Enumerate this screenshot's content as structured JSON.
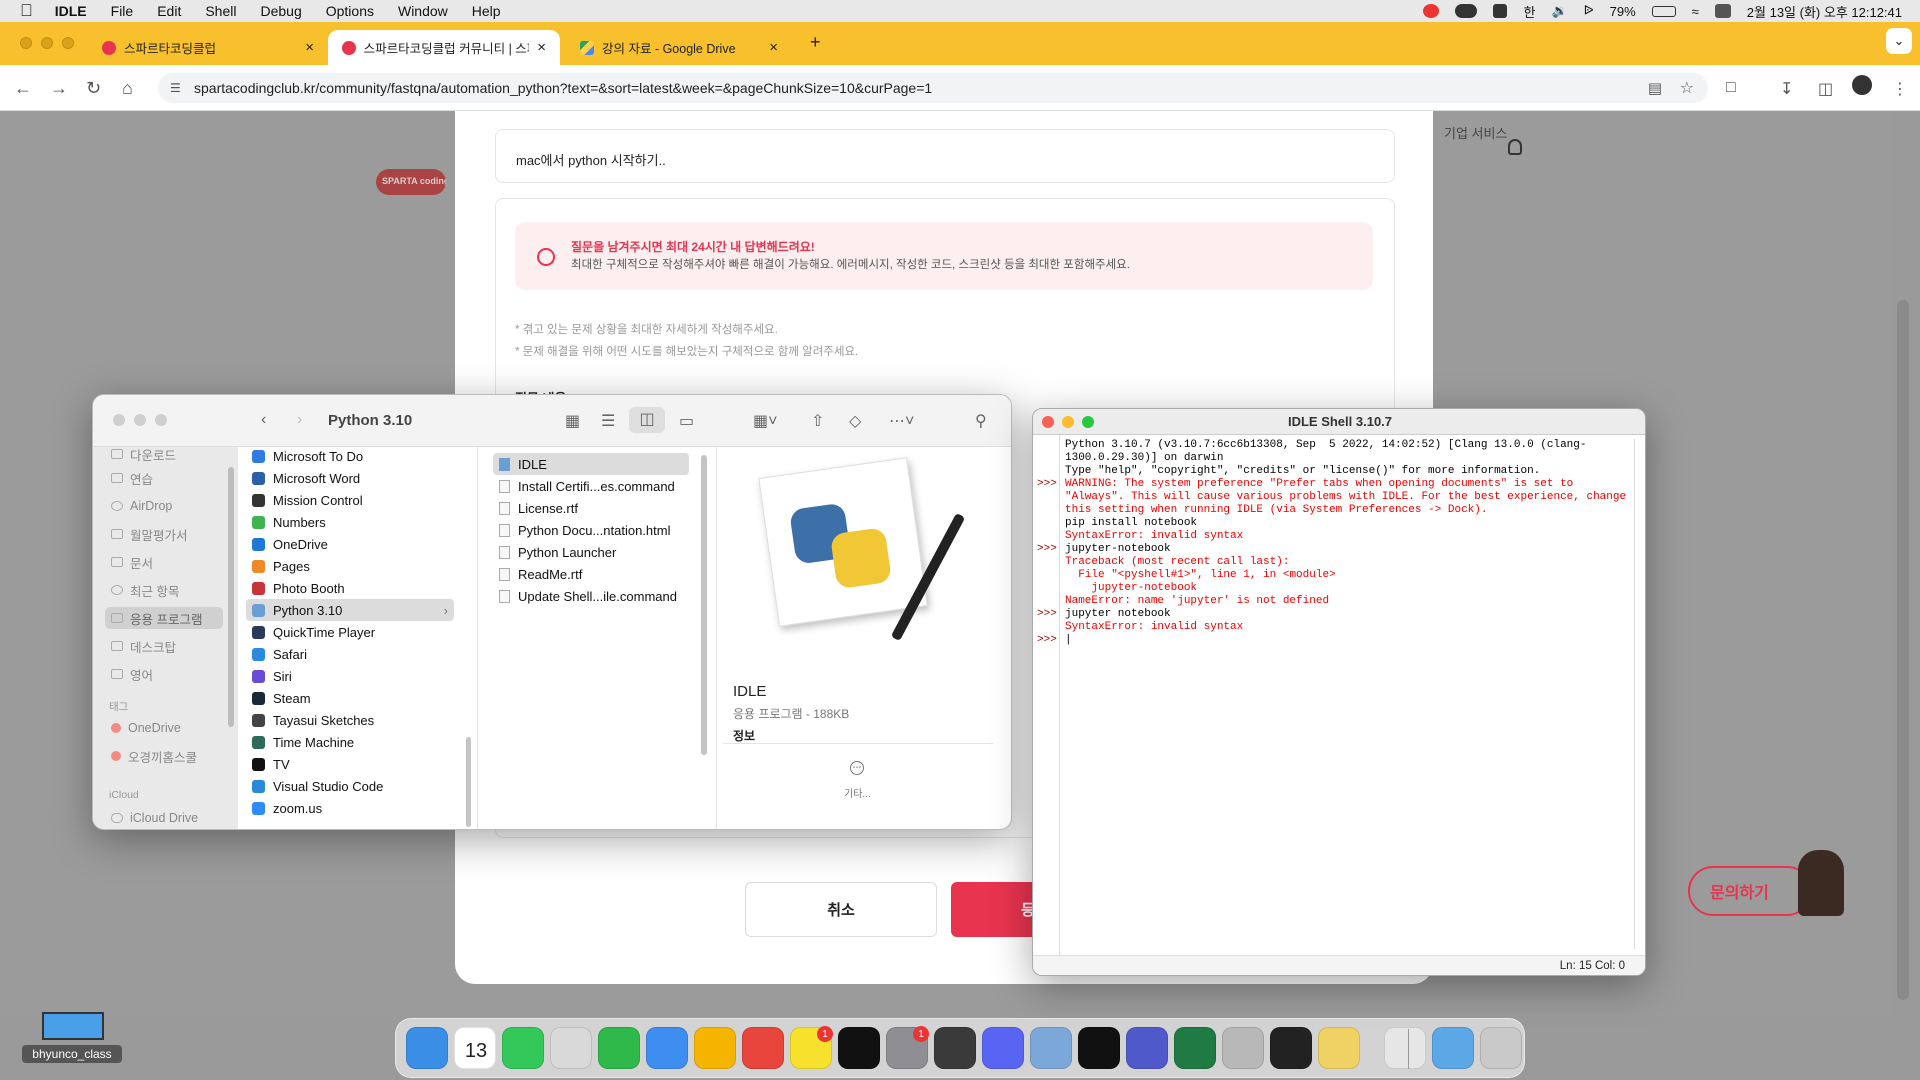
{
  "menubar": {
    "app": "IDLE",
    "items": [
      "File",
      "Edit",
      "Shell",
      "Debug",
      "Options",
      "Window",
      "Help"
    ],
    "battery": "79%",
    "datetime": "2월 13일 (화) 오후 12:12:41",
    "input_method": "한"
  },
  "browser": {
    "tabs": [
      {
        "label": "스파르타코딩클럽",
        "active": false
      },
      {
        "label": "스파르타코딩클럽 커뮤니티 | 스파르",
        "active": true
      },
      {
        "label": "강의 자료 - Google Drive",
        "active": false
      }
    ],
    "url": "spartacodingclub.kr/community/fastqna/automation_python?text=&sort=latest&week=&pageChunkSize=10&curPage=1"
  },
  "webpage": {
    "logo": "SPARTA coding club",
    "nav_link": "기업 서비스",
    "title_value": "mac에서 python 시작하기..",
    "notice_title": "질문을 남겨주시면 최대 24시간 내 답변해드려요!",
    "notice_body": "최대한 구체적으로 작성해주셔야 빠른 해결이 가능해요. 에러메시지, 작성한 코드, 스크린샷 등을 최대한 포함해주세요.",
    "hint1": "* 겪고 있는 문제 상황을 최대한 자세하게 작성해주세요.",
    "hint2": "* 문제 해결을 위해 어떤 시도를 해보았는지 구체적으로 함께 알려주세요.",
    "section_label": "질문 내용",
    "cancel_label": "취소",
    "submit_label": "등",
    "inquiry_label": "문의하기"
  },
  "finder": {
    "title": "Python 3.10",
    "sidebar": [
      {
        "label": "다운로드"
      },
      {
        "label": "연습"
      },
      {
        "label": "AirDrop"
      },
      {
        "label": "월말평가서"
      },
      {
        "label": "문서"
      },
      {
        "label": "최근 항목"
      },
      {
        "label": "응용 프로그램",
        "selected": true
      },
      {
        "label": "데스크탑"
      },
      {
        "label": "영어"
      }
    ],
    "tags_header": "태그",
    "tags": [
      {
        "label": "OneDrive",
        "color": "#f28b82"
      },
      {
        "label": "오경끼홈스쿨",
        "color": "#f28b82"
      }
    ],
    "icloud_header": "iCloud",
    "icloud_item": "iCloud Drive",
    "apps": [
      {
        "label": "Microsoft To Do",
        "color": "#2f7be0"
      },
      {
        "label": "Microsoft Word",
        "color": "#2b5faa"
      },
      {
        "label": "Mission Control",
        "color": "#333333"
      },
      {
        "label": "Numbers",
        "color": "#3fb34f"
      },
      {
        "label": "OneDrive",
        "color": "#1e78d6"
      },
      {
        "label": "Pages",
        "color": "#f08a24"
      },
      {
        "label": "Photo Booth",
        "color": "#c8323a"
      },
      {
        "label": "Python 3.10",
        "color": "#6a9fd4",
        "selected": true
      },
      {
        "label": "QuickTime Player",
        "color": "#2a3b5a"
      },
      {
        "label": "Safari",
        "color": "#2a8ae0"
      },
      {
        "label": "Siri",
        "color": "#6a4bd8"
      },
      {
        "label": "Steam",
        "color": "#1b2838"
      },
      {
        "label": "Tayasui Sketches",
        "color": "#444444"
      },
      {
        "label": "Time Machine",
        "color": "#2e6b5a"
      },
      {
        "label": "TV",
        "color": "#111111"
      },
      {
        "label": "Visual Studio Code",
        "color": "#2a8ad8"
      },
      {
        "label": "zoom.us",
        "color": "#2d8cff"
      }
    ],
    "files": [
      {
        "label": "IDLE",
        "selected": true
      },
      {
        "label": "Install Certifi...es.command"
      },
      {
        "label": "License.rtf"
      },
      {
        "label": "Python Docu...ntation.html"
      },
      {
        "label": "Python Launcher"
      },
      {
        "label": "ReadMe.rtf"
      },
      {
        "label": "Update Shell...ile.command"
      }
    ],
    "preview_name": "IDLE",
    "preview_kind": "응용 프로그램 - 188KB",
    "preview_info": "정보",
    "preview_more": "기타..."
  },
  "idle": {
    "title": "IDLE Shell 3.10.7",
    "lines": [
      {
        "prompt": "",
        "text": "Python 3.10.7 (v3.10.7:6cc6b13308, Sep  5 2022, 14:02:52) [Clang 13.0.0 (clang-1300.0.29.30)] on darwin",
        "error": false
      },
      {
        "prompt": "",
        "text": "Type \"help\", \"copyright\", \"credits\" or \"license()\" for more information.",
        "error": false
      },
      {
        "prompt": ">>>",
        "text": "WARNING: The system preference \"Prefer tabs when opening documents\" is set to \"Always\". This will cause various problems with IDLE. For the best experience, change this setting when running IDLE (via System Preferences -> Dock).",
        "error": true
      },
      {
        "prompt": "",
        "text": "pip install notebook",
        "error": false
      },
      {
        "prompt": "",
        "text": "SyntaxError: invalid syntax",
        "error": true
      },
      {
        "prompt": ">>>",
        "text": "jupyter-notebook",
        "error": false
      },
      {
        "prompt": "",
        "text": "Traceback (most recent call last):",
        "error": true
      },
      {
        "prompt": "",
        "text": "  File \"<pyshell#1>\", line 1, in <module>",
        "error": true
      },
      {
        "prompt": "",
        "text": "    jupyter-notebook",
        "error": true
      },
      {
        "prompt": "",
        "text": "NameError: name 'jupyter' is not defined",
        "error": true
      },
      {
        "prompt": ">>>",
        "text": "jupyter notebook",
        "error": false
      },
      {
        "prompt": "",
        "text": "SyntaxError: invalid syntax",
        "error": true
      },
      {
        "prompt": ">>>",
        "text": "|",
        "error": false
      }
    ],
    "status": "Ln: 15   Col: 0"
  },
  "desktop": {
    "folder_label": "bhyunco_class"
  },
  "dock": {
    "apps": [
      {
        "name": "Finder",
        "color": "#3a8ee6"
      },
      {
        "name": "Calendar",
        "color": "#ffffff",
        "label": "13"
      },
      {
        "name": "Messages",
        "color": "#34c759"
      },
      {
        "name": "Launchpad",
        "color": "#d9d9d9"
      },
      {
        "name": "FaceTime",
        "color": "#2fb94a"
      },
      {
        "name": "Mail",
        "color": "#3d8ef0"
      },
      {
        "name": "Photos",
        "color": "#f4b400"
      },
      {
        "name": "Chrome",
        "color": "#e8453c"
      },
      {
        "name": "KakaoTalk",
        "color": "#f7e12c",
        "badge": "1"
      },
      {
        "name": "Tayasui",
        "color": "#111111"
      },
      {
        "name": "System Settings",
        "color": "#8e8e93",
        "badge": "1"
      },
      {
        "name": "Calculator",
        "color": "#3a3a3a"
      },
      {
        "name": "Discord",
        "color": "#5865f2"
      },
      {
        "name": "Preview",
        "color": "#7ba7d9"
      },
      {
        "name": "CapCut",
        "color": "#111111"
      },
      {
        "name": "Teams",
        "color": "#5059c9"
      },
      {
        "name": "Excel",
        "color": "#1f7a43"
      },
      {
        "name": "Rocket",
        "color": "#b8b8b8"
      },
      {
        "name": "Terminal",
        "color": "#222222"
      },
      {
        "name": "Python Launcher",
        "color": "#f0d264"
      },
      {
        "name": "Downloads stack",
        "color": "#e6e6e6"
      },
      {
        "name": "Folder",
        "color": "#5ca8e6"
      },
      {
        "name": "Trash",
        "color": "#c9c9c9"
      }
    ]
  }
}
